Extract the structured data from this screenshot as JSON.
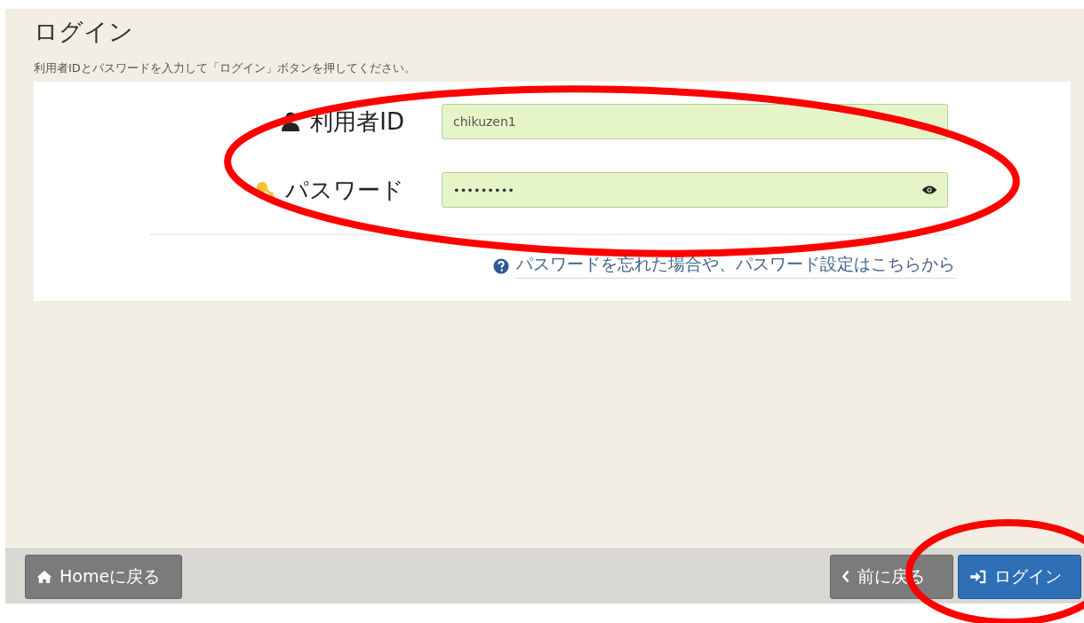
{
  "page": {
    "title": "ログイン",
    "instruction": "利用者IDとパスワードを入力して「ログイン」ボタンを押してください。"
  },
  "form": {
    "fields": [
      {
        "kind": "text",
        "label": "利用者ID",
        "value": "chikuzen1"
      },
      {
        "kind": "password",
        "label": "パスワード",
        "value": "•••••••••"
      }
    ],
    "help_link": "パスワードを忘れた場合や、パスワード設定はこちらから"
  },
  "footer": {
    "buttons": [
      {
        "kind": "home",
        "label": "Homeに戻る"
      },
      {
        "kind": "back",
        "label": "前に戻る"
      },
      {
        "kind": "login",
        "label": "ログイン"
      }
    ]
  },
  "annotations": [
    {
      "kind": "ellipse"
    },
    {
      "kind": "ellipse"
    }
  ]
}
